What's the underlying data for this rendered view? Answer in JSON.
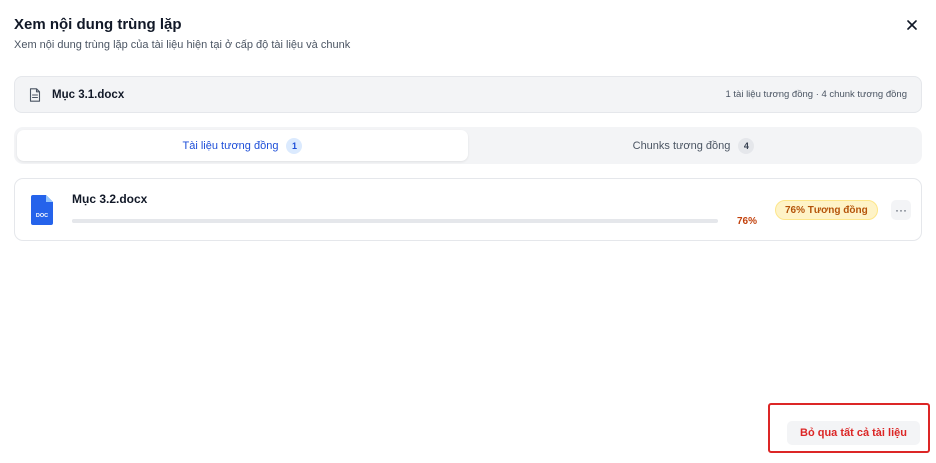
{
  "dialog": {
    "title": "Xem nội dung trùng lặp",
    "subtitle": "Xem nội dung trùng lặp của tài liệu hiện tại ở cấp độ tài liệu và chunk",
    "close_icon": "close-icon"
  },
  "current_file": {
    "name": "Mục 3.1.docx",
    "summary": "1 tài liệu tương đồng · 4 chunk tương đồng",
    "icon": "document-icon"
  },
  "tabs": [
    {
      "label": "Tài liệu tương đồng",
      "count": "1",
      "active": true
    },
    {
      "label": "Chunks tương đồng",
      "count": "4",
      "active": false
    }
  ],
  "similar_docs": [
    {
      "name": "Mục 3.2.docx",
      "icon_text": "DOC",
      "similarity": 0.76,
      "percent_label": "76%",
      "badge": "76% Tương đồng",
      "more_label": "···"
    }
  ],
  "actions": {
    "skip_all": "Bỏ qua tất cả tài liệu"
  },
  "colors": {
    "accent": "#1d4ed8",
    "danger": "#dc2626",
    "badge_bg": "#fef3c7",
    "badge_text": "#b45309",
    "percent": "#c2410c",
    "doc_icon": "#2563eb"
  }
}
